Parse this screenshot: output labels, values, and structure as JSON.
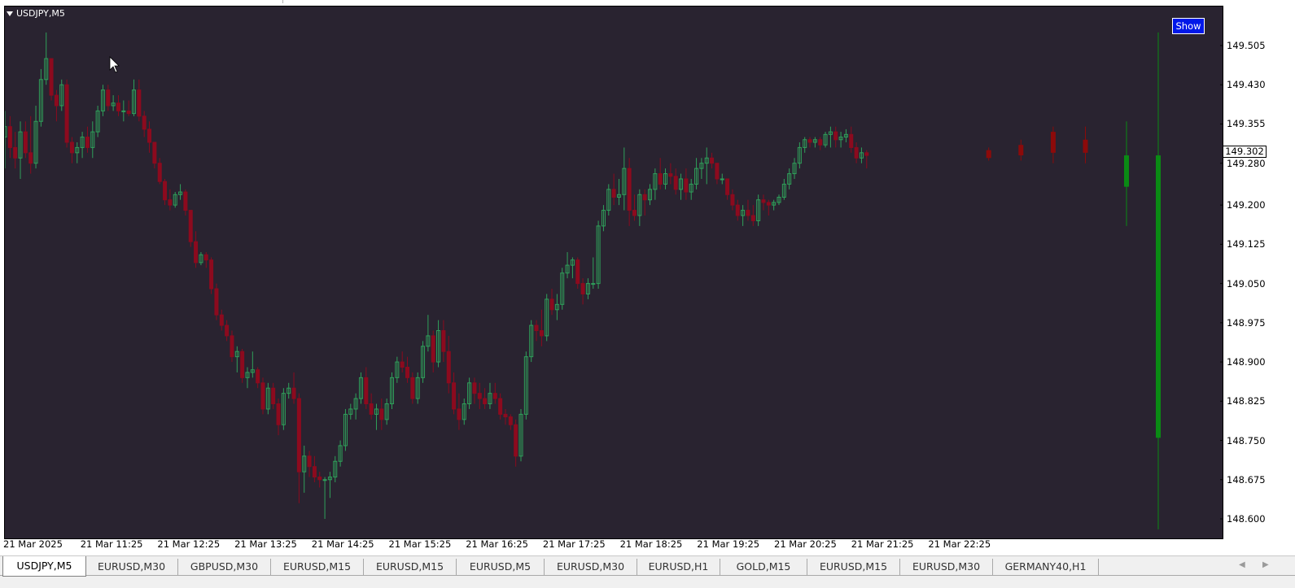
{
  "window": {
    "symbol_title": "USDJPY,M5",
    "show_button": "Show",
    "current_price": "149.302"
  },
  "colors": {
    "background": "#292330",
    "bull": "#2fa05a",
    "bear": "#8c0a1e",
    "projection_bull": "#0a8a14",
    "projection_bear": "#8c0a0a"
  },
  "axis": {
    "price_ticks": [
      "149.505",
      "149.430",
      "149.355",
      "149.280",
      "149.200",
      "149.125",
      "149.050",
      "148.975",
      "148.900",
      "148.825",
      "148.750",
      "148.675",
      "148.600"
    ],
    "time_ticks": [
      "21 Mar 2025",
      "21 Mar 11:25",
      "21 Mar 12:25",
      "21 Mar 13:25",
      "21 Mar 14:25",
      "21 Mar 15:25",
      "21 Mar 16:25",
      "21 Mar 17:25",
      "21 Mar 18:25",
      "21 Mar 19:25",
      "21 Mar 20:25",
      "21 Mar 21:25",
      "21 Mar 22:25"
    ]
  },
  "tabs": [
    {
      "label": "USDJPY,M5",
      "active": true
    },
    {
      "label": "EURUSD,M30",
      "active": false
    },
    {
      "label": "GBPUSD,M30",
      "active": false
    },
    {
      "label": "EURUSD,M15",
      "active": false
    },
    {
      "label": "EURUSD,M15",
      "active": false
    },
    {
      "label": "EURUSD,M5",
      "active": false
    },
    {
      "label": "EURUSD,M30",
      "active": false
    },
    {
      "label": "EURUSD,H1",
      "active": false
    },
    {
      "label": "GOLD,M15",
      "active": false
    },
    {
      "label": "EURUSD,M15",
      "active": false
    },
    {
      "label": "EURUSD,M30",
      "active": false
    },
    {
      "label": "GERMANY40,H1",
      "active": false
    }
  ],
  "chart_data": {
    "type": "candlestick",
    "symbol": "USDJPY",
    "timeframe": "M5",
    "ylim": [
      148.58,
      149.56
    ],
    "grid": false,
    "current_price": 149.302,
    "candles": [
      {
        "o": 149.33,
        "h": 149.38,
        "l": 149.27,
        "c": 149.35
      },
      {
        "o": 149.35,
        "h": 149.37,
        "l": 149.29,
        "c": 149.31
      },
      {
        "o": 149.31,
        "h": 149.34,
        "l": 149.27,
        "c": 149.29
      },
      {
        "o": 149.29,
        "h": 149.36,
        "l": 149.25,
        "c": 149.34
      },
      {
        "o": 149.34,
        "h": 149.36,
        "l": 149.29,
        "c": 149.3
      },
      {
        "o": 149.3,
        "h": 149.37,
        "l": 149.26,
        "c": 149.28
      },
      {
        "o": 149.28,
        "h": 149.39,
        "l": 149.27,
        "c": 149.36
      },
      {
        "o": 149.36,
        "h": 149.46,
        "l": 149.35,
        "c": 149.44
      },
      {
        "o": 149.44,
        "h": 149.53,
        "l": 149.43,
        "c": 149.48
      },
      {
        "o": 149.48,
        "h": 149.48,
        "l": 149.4,
        "c": 149.41
      },
      {
        "o": 149.41,
        "h": 149.42,
        "l": 149.36,
        "c": 149.39
      },
      {
        "o": 149.39,
        "h": 149.44,
        "l": 149.38,
        "c": 149.43
      },
      {
        "o": 149.43,
        "h": 149.44,
        "l": 149.31,
        "c": 149.32
      },
      {
        "o": 149.32,
        "h": 149.33,
        "l": 149.28,
        "c": 149.3
      },
      {
        "o": 149.3,
        "h": 149.32,
        "l": 149.28,
        "c": 149.31
      },
      {
        "o": 149.31,
        "h": 149.34,
        "l": 149.29,
        "c": 149.33
      },
      {
        "o": 149.33,
        "h": 149.35,
        "l": 149.3,
        "c": 149.31
      },
      {
        "o": 149.31,
        "h": 149.36,
        "l": 149.29,
        "c": 149.34
      },
      {
        "o": 149.34,
        "h": 149.39,
        "l": 149.33,
        "c": 149.38
      },
      {
        "o": 149.38,
        "h": 149.43,
        "l": 149.37,
        "c": 149.42
      },
      {
        "o": 149.42,
        "h": 149.43,
        "l": 149.38,
        "c": 149.39
      },
      {
        "o": 149.39,
        "h": 149.41,
        "l": 149.38,
        "c": 149.395
      },
      {
        "o": 149.395,
        "h": 149.41,
        "l": 149.37,
        "c": 149.38
      },
      {
        "o": 149.38,
        "h": 149.4,
        "l": 149.36,
        "c": 149.38
      },
      {
        "o": 149.38,
        "h": 149.4,
        "l": 149.37,
        "c": 149.375
      },
      {
        "o": 149.375,
        "h": 149.44,
        "l": 149.37,
        "c": 149.42
      },
      {
        "o": 149.42,
        "h": 149.44,
        "l": 149.36,
        "c": 149.37
      },
      {
        "o": 149.37,
        "h": 149.38,
        "l": 149.33,
        "c": 149.345
      },
      {
        "o": 149.345,
        "h": 149.36,
        "l": 149.3,
        "c": 149.32
      },
      {
        "o": 149.32,
        "h": 149.32,
        "l": 149.27,
        "c": 149.28
      },
      {
        "o": 149.28,
        "h": 149.29,
        "l": 149.24,
        "c": 149.245
      },
      {
        "o": 149.245,
        "h": 149.25,
        "l": 149.2,
        "c": 149.21
      },
      {
        "o": 149.21,
        "h": 149.23,
        "l": 149.19,
        "c": 149.2
      },
      {
        "o": 149.2,
        "h": 149.225,
        "l": 149.195,
        "c": 149.22
      },
      {
        "o": 149.22,
        "h": 149.24,
        "l": 149.21,
        "c": 149.225
      },
      {
        "o": 149.225,
        "h": 149.23,
        "l": 149.18,
        "c": 149.19
      },
      {
        "o": 149.19,
        "h": 149.19,
        "l": 149.12,
        "c": 149.13
      },
      {
        "o": 149.13,
        "h": 149.15,
        "l": 149.08,
        "c": 149.09
      },
      {
        "o": 149.09,
        "h": 149.11,
        "l": 149.085,
        "c": 149.105
      },
      {
        "o": 149.105,
        "h": 149.11,
        "l": 149.08,
        "c": 149.095
      },
      {
        "o": 149.095,
        "h": 149.1,
        "l": 149.03,
        "c": 149.04
      },
      {
        "o": 149.04,
        "h": 149.05,
        "l": 148.98,
        "c": 148.99
      },
      {
        "o": 148.99,
        "h": 149.0,
        "l": 148.96,
        "c": 148.97
      },
      {
        "o": 148.97,
        "h": 148.98,
        "l": 148.94,
        "c": 148.95
      },
      {
        "o": 148.95,
        "h": 148.96,
        "l": 148.9,
        "c": 148.91
      },
      {
        "o": 148.91,
        "h": 148.93,
        "l": 148.88,
        "c": 148.92
      },
      {
        "o": 148.92,
        "h": 148.925,
        "l": 148.86,
        "c": 148.87
      },
      {
        "o": 148.87,
        "h": 148.89,
        "l": 148.85,
        "c": 148.88
      },
      {
        "o": 148.88,
        "h": 148.92,
        "l": 148.87,
        "c": 148.885
      },
      {
        "o": 148.885,
        "h": 148.89,
        "l": 148.85,
        "c": 148.86
      },
      {
        "o": 148.86,
        "h": 148.87,
        "l": 148.8,
        "c": 148.81
      },
      {
        "o": 148.81,
        "h": 148.86,
        "l": 148.8,
        "c": 148.85
      },
      {
        "o": 148.85,
        "h": 148.86,
        "l": 148.81,
        "c": 148.82
      },
      {
        "o": 148.82,
        "h": 148.83,
        "l": 148.76,
        "c": 148.78
      },
      {
        "o": 148.78,
        "h": 148.85,
        "l": 148.77,
        "c": 148.84
      },
      {
        "o": 148.84,
        "h": 148.86,
        "l": 148.83,
        "c": 148.85
      },
      {
        "o": 148.85,
        "h": 148.88,
        "l": 148.82,
        "c": 148.83
      },
      {
        "o": 148.83,
        "h": 148.84,
        "l": 148.63,
        "c": 148.69
      },
      {
        "o": 148.69,
        "h": 148.74,
        "l": 148.65,
        "c": 148.72
      },
      {
        "o": 148.72,
        "h": 148.73,
        "l": 148.68,
        "c": 148.7
      },
      {
        "o": 148.7,
        "h": 148.72,
        "l": 148.67,
        "c": 148.68
      },
      {
        "o": 148.68,
        "h": 148.69,
        "l": 148.66,
        "c": 148.675
      },
      {
        "o": 148.675,
        "h": 148.68,
        "l": 148.6,
        "c": 148.675
      },
      {
        "o": 148.675,
        "h": 148.69,
        "l": 148.64,
        "c": 148.68
      },
      {
        "o": 148.68,
        "h": 148.72,
        "l": 148.67,
        "c": 148.71
      },
      {
        "o": 148.71,
        "h": 148.75,
        "l": 148.7,
        "c": 148.74
      },
      {
        "o": 148.74,
        "h": 148.81,
        "l": 148.73,
        "c": 148.8
      },
      {
        "o": 148.8,
        "h": 148.82,
        "l": 148.79,
        "c": 148.81
      },
      {
        "o": 148.81,
        "h": 148.84,
        "l": 148.79,
        "c": 148.83
      },
      {
        "o": 148.83,
        "h": 148.88,
        "l": 148.82,
        "c": 148.87
      },
      {
        "o": 148.87,
        "h": 148.89,
        "l": 148.81,
        "c": 148.82
      },
      {
        "o": 148.82,
        "h": 148.84,
        "l": 148.79,
        "c": 148.8
      },
      {
        "o": 148.8,
        "h": 148.82,
        "l": 148.77,
        "c": 148.81
      },
      {
        "o": 148.81,
        "h": 148.83,
        "l": 148.77,
        "c": 148.79
      },
      {
        "o": 148.79,
        "h": 148.83,
        "l": 148.78,
        "c": 148.82
      },
      {
        "o": 148.82,
        "h": 148.88,
        "l": 148.81,
        "c": 148.87
      },
      {
        "o": 148.87,
        "h": 148.91,
        "l": 148.86,
        "c": 148.9
      },
      {
        "o": 148.9,
        "h": 148.92,
        "l": 148.88,
        "c": 148.89
      },
      {
        "o": 148.89,
        "h": 148.91,
        "l": 148.86,
        "c": 148.87
      },
      {
        "o": 148.87,
        "h": 148.88,
        "l": 148.82,
        "c": 148.83
      },
      {
        "o": 148.83,
        "h": 148.88,
        "l": 148.82,
        "c": 148.87
      },
      {
        "o": 148.87,
        "h": 148.94,
        "l": 148.86,
        "c": 148.93
      },
      {
        "o": 148.93,
        "h": 148.99,
        "l": 148.92,
        "c": 148.95
      },
      {
        "o": 148.95,
        "h": 148.96,
        "l": 148.88,
        "c": 148.9
      },
      {
        "o": 148.9,
        "h": 148.98,
        "l": 148.89,
        "c": 148.96
      },
      {
        "o": 148.96,
        "h": 148.98,
        "l": 148.9,
        "c": 148.92
      },
      {
        "o": 148.92,
        "h": 148.95,
        "l": 148.84,
        "c": 148.86
      },
      {
        "o": 148.86,
        "h": 148.88,
        "l": 148.8,
        "c": 148.81
      },
      {
        "o": 148.81,
        "h": 148.84,
        "l": 148.77,
        "c": 148.79
      },
      {
        "o": 148.79,
        "h": 148.83,
        "l": 148.78,
        "c": 148.82
      },
      {
        "o": 148.82,
        "h": 148.87,
        "l": 148.81,
        "c": 148.86
      },
      {
        "o": 148.86,
        "h": 148.87,
        "l": 148.82,
        "c": 148.84
      },
      {
        "o": 148.84,
        "h": 148.86,
        "l": 148.81,
        "c": 148.83
      },
      {
        "o": 148.83,
        "h": 148.85,
        "l": 148.81,
        "c": 148.82
      },
      {
        "o": 148.82,
        "h": 148.86,
        "l": 148.81,
        "c": 148.84
      },
      {
        "o": 148.84,
        "h": 148.86,
        "l": 148.82,
        "c": 148.83
      },
      {
        "o": 148.83,
        "h": 148.84,
        "l": 148.79,
        "c": 148.8
      },
      {
        "o": 148.8,
        "h": 148.81,
        "l": 148.78,
        "c": 148.795
      },
      {
        "o": 148.795,
        "h": 148.8,
        "l": 148.77,
        "c": 148.78
      },
      {
        "o": 148.78,
        "h": 148.79,
        "l": 148.7,
        "c": 148.72
      },
      {
        "o": 148.72,
        "h": 148.81,
        "l": 148.71,
        "c": 148.8
      },
      {
        "o": 148.8,
        "h": 148.92,
        "l": 148.79,
        "c": 148.91
      },
      {
        "o": 148.91,
        "h": 148.98,
        "l": 148.9,
        "c": 148.97
      },
      {
        "o": 148.97,
        "h": 148.98,
        "l": 148.94,
        "c": 148.96
      },
      {
        "o": 148.96,
        "h": 149.0,
        "l": 148.93,
        "c": 148.95
      },
      {
        "o": 148.95,
        "h": 149.03,
        "l": 148.94,
        "c": 149.02
      },
      {
        "o": 149.02,
        "h": 149.04,
        "l": 148.99,
        "c": 149.0
      },
      {
        "o": 149.0,
        "h": 149.03,
        "l": 148.98,
        "c": 149.01
      },
      {
        "o": 149.01,
        "h": 149.08,
        "l": 149.0,
        "c": 149.07
      },
      {
        "o": 149.07,
        "h": 149.11,
        "l": 149.06,
        "c": 149.085
      },
      {
        "o": 149.085,
        "h": 149.1,
        "l": 149.06,
        "c": 149.095
      },
      {
        "o": 149.095,
        "h": 149.1,
        "l": 149.04,
        "c": 149.05
      },
      {
        "o": 149.05,
        "h": 149.06,
        "l": 149.01,
        "c": 149.03
      },
      {
        "o": 149.03,
        "h": 149.06,
        "l": 149.02,
        "c": 149.05
      },
      {
        "o": 149.05,
        "h": 149.1,
        "l": 149.04,
        "c": 149.05
      },
      {
        "o": 149.05,
        "h": 149.17,
        "l": 149.04,
        "c": 149.16
      },
      {
        "o": 149.16,
        "h": 149.2,
        "l": 149.15,
        "c": 149.19
      },
      {
        "o": 149.19,
        "h": 149.24,
        "l": 149.18,
        "c": 149.23
      },
      {
        "o": 149.23,
        "h": 149.26,
        "l": 149.2,
        "c": 149.215
      },
      {
        "o": 149.215,
        "h": 149.25,
        "l": 149.2,
        "c": 149.22
      },
      {
        "o": 149.22,
        "h": 149.31,
        "l": 149.19,
        "c": 149.27
      },
      {
        "o": 149.27,
        "h": 149.29,
        "l": 149.16,
        "c": 149.19
      },
      {
        "o": 149.19,
        "h": 149.22,
        "l": 149.17,
        "c": 149.18
      },
      {
        "o": 149.18,
        "h": 149.23,
        "l": 149.16,
        "c": 149.22
      },
      {
        "o": 149.22,
        "h": 149.23,
        "l": 149.18,
        "c": 149.21
      },
      {
        "o": 149.21,
        "h": 149.24,
        "l": 149.2,
        "c": 149.23
      },
      {
        "o": 149.23,
        "h": 149.27,
        "l": 149.21,
        "c": 149.26
      },
      {
        "o": 149.26,
        "h": 149.29,
        "l": 149.23,
        "c": 149.24
      },
      {
        "o": 149.24,
        "h": 149.27,
        "l": 149.23,
        "c": 149.26
      },
      {
        "o": 149.26,
        "h": 149.28,
        "l": 149.24,
        "c": 149.255
      },
      {
        "o": 149.255,
        "h": 149.27,
        "l": 149.22,
        "c": 149.23
      },
      {
        "o": 149.23,
        "h": 149.26,
        "l": 149.21,
        "c": 149.25
      },
      {
        "o": 149.25,
        "h": 149.27,
        "l": 149.21,
        "c": 149.225
      },
      {
        "o": 149.225,
        "h": 149.25,
        "l": 149.21,
        "c": 149.24
      },
      {
        "o": 149.24,
        "h": 149.29,
        "l": 149.23,
        "c": 149.27
      },
      {
        "o": 149.27,
        "h": 149.29,
        "l": 149.25,
        "c": 149.28
      },
      {
        "o": 149.28,
        "h": 149.31,
        "l": 149.24,
        "c": 149.29
      },
      {
        "o": 149.29,
        "h": 149.3,
        "l": 149.27,
        "c": 149.28
      },
      {
        "o": 149.28,
        "h": 149.28,
        "l": 149.24,
        "c": 149.25
      },
      {
        "o": 149.25,
        "h": 149.26,
        "l": 149.24,
        "c": 149.25
      },
      {
        "o": 149.25,
        "h": 149.25,
        "l": 149.21,
        "c": 149.22
      },
      {
        "o": 149.22,
        "h": 149.23,
        "l": 149.19,
        "c": 149.2
      },
      {
        "o": 149.2,
        "h": 149.21,
        "l": 149.17,
        "c": 149.18
      },
      {
        "o": 149.18,
        "h": 149.2,
        "l": 149.16,
        "c": 149.19
      },
      {
        "o": 149.19,
        "h": 149.21,
        "l": 149.17,
        "c": 149.18
      },
      {
        "o": 149.18,
        "h": 149.2,
        "l": 149.16,
        "c": 149.17
      },
      {
        "o": 149.17,
        "h": 149.22,
        "l": 149.16,
        "c": 149.21
      },
      {
        "o": 149.21,
        "h": 149.22,
        "l": 149.19,
        "c": 149.205
      },
      {
        "o": 149.205,
        "h": 149.21,
        "l": 149.18,
        "c": 149.2
      },
      {
        "o": 149.2,
        "h": 149.21,
        "l": 149.19,
        "c": 149.205
      },
      {
        "o": 149.205,
        "h": 149.22,
        "l": 149.2,
        "c": 149.215
      },
      {
        "o": 149.215,
        "h": 149.25,
        "l": 149.21,
        "c": 149.24
      },
      {
        "o": 149.24,
        "h": 149.27,
        "l": 149.23,
        "c": 149.26
      },
      {
        "o": 149.26,
        "h": 149.29,
        "l": 149.25,
        "c": 149.28
      },
      {
        "o": 149.28,
        "h": 149.32,
        "l": 149.27,
        "c": 149.31
      },
      {
        "o": 149.31,
        "h": 149.33,
        "l": 149.3,
        "c": 149.325
      },
      {
        "o": 149.325,
        "h": 149.33,
        "l": 149.31,
        "c": 149.32
      },
      {
        "o": 149.32,
        "h": 149.33,
        "l": 149.31,
        "c": 149.325
      },
      {
        "o": 149.325,
        "h": 149.33,
        "l": 149.305,
        "c": 149.315
      },
      {
        "o": 149.315,
        "h": 149.34,
        "l": 149.31,
        "c": 149.335
      },
      {
        "o": 149.335,
        "h": 149.35,
        "l": 149.31,
        "c": 149.34
      },
      {
        "o": 149.34,
        "h": 149.35,
        "l": 149.31,
        "c": 149.325
      },
      {
        "o": 149.325,
        "h": 149.34,
        "l": 149.31,
        "c": 149.33
      },
      {
        "o": 149.33,
        "h": 149.345,
        "l": 149.32,
        "c": 149.335
      },
      {
        "o": 149.335,
        "h": 149.35,
        "l": 149.3,
        "c": 149.31
      },
      {
        "o": 149.31,
        "h": 149.32,
        "l": 149.28,
        "c": 149.29
      },
      {
        "o": 149.29,
        "h": 149.31,
        "l": 149.28,
        "c": 149.3
      },
      {
        "o": 149.3,
        "h": 149.305,
        "l": 149.27,
        "c": 149.295
      }
    ],
    "projection_candles": [
      {
        "o": 149.305,
        "h": 149.31,
        "l": 149.285,
        "c": 149.29,
        "x_offset": 3
      },
      {
        "o": 149.315,
        "h": 149.325,
        "l": 149.285,
        "c": 149.295,
        "x_offset": 7
      },
      {
        "o": 149.34,
        "h": 149.35,
        "l": 149.28,
        "c": 149.3,
        "x_offset": 11
      },
      {
        "o": 149.325,
        "h": 149.35,
        "l": 149.28,
        "c": 149.3,
        "x_offset": 15
      }
    ],
    "large_bars": [
      {
        "o": 149.235,
        "h": 149.36,
        "l": 149.16,
        "c": 149.295,
        "kind": "bull"
      },
      {
        "o": 148.755,
        "h": 149.53,
        "l": 148.58,
        "c": 149.295,
        "kind": "bull"
      }
    ]
  }
}
